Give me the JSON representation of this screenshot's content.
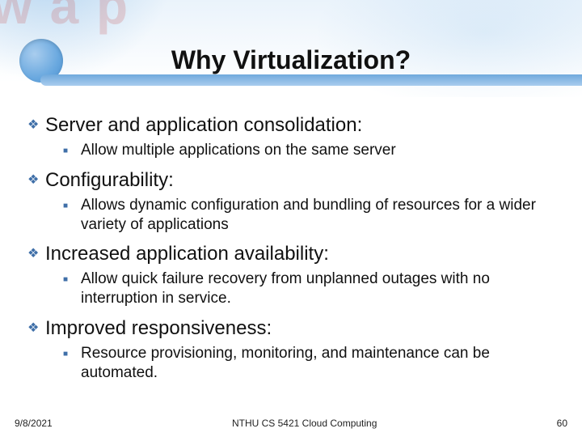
{
  "bg_logo_text": "w a p",
  "title": "Why Virtualization?",
  "points": [
    {
      "heading": "Server and application consolidation:",
      "subs": [
        "Allow multiple applications on the same server"
      ]
    },
    {
      "heading": "Configurability:",
      "subs": [
        "Allows dynamic configuration and bundling of resources for a wider variety of applications"
      ]
    },
    {
      "heading": "Increased application availability:",
      "subs": [
        "Allow quick failure recovery from unplanned outages with no interruption in service."
      ]
    },
    {
      "heading": "Improved responsiveness:",
      "subs": [
        "Resource provisioning, monitoring, and maintenance can be automated."
      ]
    }
  ],
  "footer": {
    "date": "9/8/2021",
    "center": "NTHU CS 5421 Cloud Computing",
    "page": "60"
  }
}
